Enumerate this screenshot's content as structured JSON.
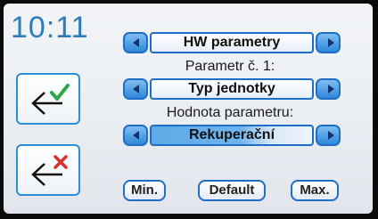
{
  "clock": {
    "time": "10:11"
  },
  "menu": {
    "title": "HW parametry"
  },
  "parameter": {
    "label": "Parametr č. 1:",
    "value": "Typ jednotky"
  },
  "parameter_value": {
    "label": "Hodnota parametru:",
    "value": "Rekuperační"
  },
  "buttons": {
    "min": "Min.",
    "default": "Default",
    "max": "Max."
  },
  "icons": {
    "confirm": "back-arrow-check-icon",
    "cancel": "back-arrow-x-icon",
    "left": "arrow-left-icon",
    "right": "arrow-right-icon"
  },
  "colors": {
    "accent_blue": "#2f88da",
    "check_green": "#2aa84a",
    "cross_red": "#d8302f",
    "clock_blue": "#2c7db7"
  }
}
